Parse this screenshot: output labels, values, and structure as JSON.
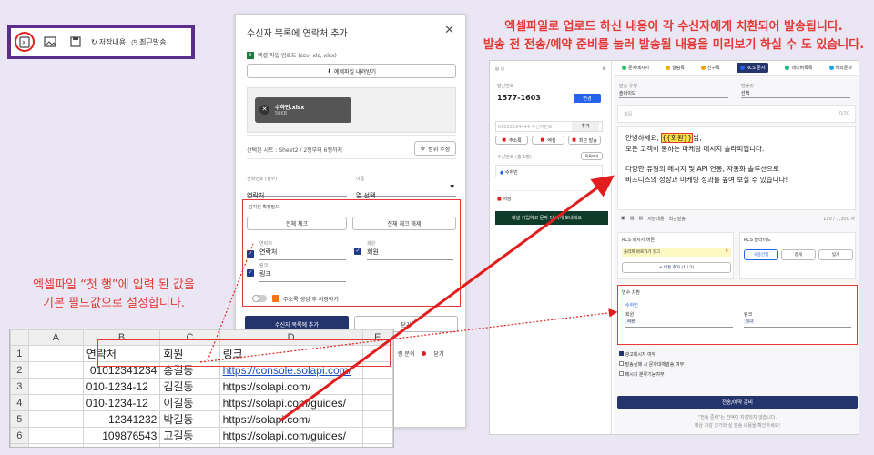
{
  "toolbar": {
    "icons": [
      "excel-upload-icon",
      "image-icon",
      "save-icon",
      "refresh-icon",
      "clock-icon"
    ],
    "saved_label": "저장내용",
    "recent_label": "최근발송"
  },
  "captions": {
    "top": [
      "엑셀파일로 업로드 하신 내용이  각 수신자에게 치환되어 발송됩니다.",
      "발송 전 전송/예약 준비를 눌러 발송될 내용을 미리보기 하실 수 도 있습니다."
    ],
    "left": [
      "엑셀파일 “첫 행”에 입력 된 값을",
      "기본 필드값으로 설정합니다."
    ]
  },
  "modal": {
    "title": "수신자 목록에 연락처 추가",
    "upload_label": "엑셀 파일 업로드 (csv, xls, xlsx)",
    "download_example": "예제파일 내려받기",
    "file_name": "수하민.xlsx",
    "file_size": "50KB",
    "sheet_info": "선택된 시트 : Sheet2 / 2행부터 6행까지",
    "range_edit": "범위 수정",
    "phone_label": "전화번호 (필수)",
    "phone_value": "연락처",
    "name_label": "이름",
    "name_value": "열 선택",
    "ext_fields_title": "감지된 확장필드",
    "select_all": "전체 체크",
    "deselect_all": "전체 체크 해제",
    "fields": [
      {
        "label": "연락처",
        "value": "연락처"
      },
      {
        "label": "회원",
        "value": "회원"
      },
      {
        "label": "링크",
        "value": "링크"
      }
    ],
    "save_addressbook": "주소록 생성 후 저장하기",
    "add_button": "수신자 목록에 추가",
    "close_button": "닫기",
    "footer_chip": "링 문의",
    "footer_close": "닫기"
  },
  "sheet": {
    "columns": [
      "",
      "A",
      "B",
      "C",
      "D",
      "E"
    ],
    "rows": [
      [
        "1",
        "",
        "연락처",
        "회원",
        "링크",
        ""
      ],
      [
        "2",
        "",
        "01012341234",
        "홍길동",
        "https://console.solapi.com/",
        ""
      ],
      [
        "3",
        "",
        "010-1234-12",
        "김길동",
        "https://solapi.com/",
        ""
      ],
      [
        "4",
        "",
        "010-1234-12",
        "이길동",
        "https://solapi.com/guides/",
        ""
      ],
      [
        "5",
        "",
        "12341232",
        "박길동",
        "https://solapi.com/",
        ""
      ],
      [
        "6",
        "",
        "109876543",
        "고길동",
        "https://solapi.com/guides/",
        ""
      ],
      [
        "7",
        "",
        "",
        "",
        "",
        ""
      ]
    ]
  },
  "app": {
    "sender_label": "발신번호",
    "sender_value": "1577-1603",
    "sender_btn": "변경",
    "input_placeholder": "01022224444 수신자번호",
    "add_btn": "추가",
    "mini_btns": [
      "주소록",
      "엑셀",
      "최근 발송"
    ],
    "recipient_label": "수신번호 (총 1명)",
    "recipient_btn": "목록보기",
    "recipient_item": "수하민",
    "saved_label": "저장",
    "banner": "채널 가입하고 문자 더 싸게 보내세요",
    "banner_sub": "",
    "tabs": [
      "문자메시지",
      "알림톡",
      "친구톡",
      "RCS 문자",
      "네이버톡톡",
      "해외문자"
    ],
    "tab_colors": [
      "#22c55e",
      "#eab308",
      "#f59e0b",
      "#2563eb",
      "#10b981",
      "#0ea5e9"
    ],
    "category_label": "발송 유형",
    "category_value": "슬라이드",
    "template_label": "템플릿",
    "template_value": "선택",
    "subject_placeholder": "제목",
    "subject_count": "0/30",
    "message_lines": [
      "안녕하세요, ",
      "님,",
      "모든 고객이 통하는 마케팅 메시지 솔라피입니다.",
      "다양한 유형의 메시지 및 API 연동, 자동화 솔루션으로",
      "비즈니스의 성장과 마케팅 성과를 높여 보실 수 있습니다!"
    ],
    "message_var": "{{회원}}",
    "msg_count": "110 / 1,300 자",
    "editor_tools": [
      "저장내용",
      "최근발송"
    ],
    "rcs_button_title": "RCS 메시지 버튼",
    "rcs_button_item": "솔라피 바로가기",
    "rcs_button_tag": "링크",
    "add_button_label": "+ 버튼 추가 (1 / 2)",
    "rcs_slide_title": "RCS 슬라이드",
    "slide_btns": [
      "사용안함",
      "좁게",
      "넓게"
    ],
    "variable_title": "변수 치환",
    "var_sub": "수하민",
    "var_fields": [
      {
        "label": "회원",
        "value": "회원"
      },
      {
        "label": "링크",
        "value": "링크"
      }
    ],
    "checkboxes": [
      "광고메시지 여부",
      "발송실패 시 문자대체발송 여부",
      "메시지 분류기능여부"
    ],
    "send_button": "전송/예약 준비",
    "footer_note": "\"전송 준비\"는 잔액이 차감되지 않습니다.",
    "footer_note2": "예상 차감 인가와 실 발송 내용을 확인하세요!"
  },
  "colors": {
    "accent": "#e11d1d",
    "navy": "#24356d",
    "purple": "#5b2d8e"
  }
}
